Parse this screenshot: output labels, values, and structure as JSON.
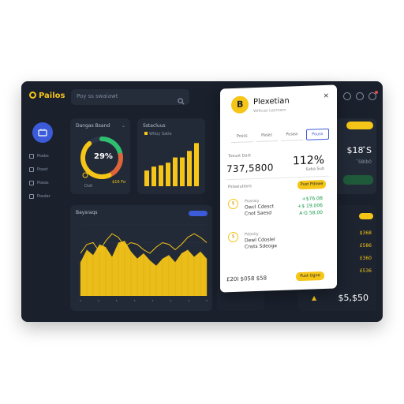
{
  "app": {
    "brand": "Pailos"
  },
  "search": {
    "placeholder": "Poy ss swaiawt"
  },
  "sidebar": {
    "items": [
      {
        "label": "Poabs"
      },
      {
        "label": "Poast"
      },
      {
        "label": "Poeas"
      },
      {
        "label": "Posdar"
      }
    ]
  },
  "cards": {
    "donut": {
      "title": "Dangas Bsand",
      "value": "29%",
      "left_note": "Dotl",
      "right_note": "$16 Fo"
    },
    "bars": {
      "title": "Sstacluus",
      "legend": "Wtloy Satle"
    },
    "area": {
      "title": "Baysraqs"
    },
    "right_top": {
      "big": "$18 ̂S",
      "sub": "ˆS8Ib0"
    },
    "right_bottom": {
      "rows": [
        "$368",
        "£586",
        "£360",
        "£536"
      ],
      "total": "$5,$50"
    }
  },
  "popup": {
    "icon_char": "B",
    "title": "Plexetian",
    "subtitle": "Wrltcas Lesroam",
    "close": "×",
    "tabs": [
      "Posss",
      "Pasec",
      "Posea",
      "Pouss"
    ],
    "meta": "Toeust Dast",
    "amount": "737,5800",
    "percent": "112%",
    "percent_sub": "$aba Sub",
    "section": "Pstseiutlons",
    "button1": "Pust Pdowe",
    "item1": {
      "line1": "Poaraiy",
      "line2": "Owcl Cdesct",
      "line3": "Cnot Saesd",
      "r1": "+$76.0B",
      "r2": "+$ 19.006",
      "r3": "A·G 58,00"
    },
    "item2": {
      "line1": "Pdosiiy",
      "line2": "Dewl Cdoslel",
      "line3": "Cnsts Sdeoga"
    },
    "footer": "£20I $058 $58",
    "button2": "Pust Ogne"
  },
  "chart_data": [
    {
      "type": "donut",
      "values": [
        29,
        71
      ],
      "value_label": "29%"
    },
    {
      "type": "bar",
      "values": [
        12,
        15,
        16,
        18,
        22,
        22,
        27,
        33
      ]
    },
    {
      "type": "area",
      "x": [
        0,
        1,
        2,
        3,
        4,
        5,
        6,
        7,
        8,
        9,
        10,
        11,
        12,
        13,
        14,
        15,
        16,
        17,
        18,
        19,
        20
      ],
      "values": [
        38,
        52,
        46,
        58,
        55,
        44,
        60,
        62,
        50,
        42,
        48,
        40,
        34,
        42,
        46,
        38,
        48,
        52,
        44,
        50,
        42
      ],
      "overlay": [
        48,
        58,
        60,
        50,
        62,
        70,
        66,
        56,
        60,
        58,
        52,
        48,
        55,
        60,
        58,
        52,
        58,
        66,
        70,
        66,
        60
      ],
      "colors": {
        "area": "#f5c518",
        "line": "#f5c518"
      }
    }
  ],
  "colors": {
    "accent": "#f5c518",
    "background": "#1a202c",
    "card": "#222a37",
    "primary_blue": "#3b5bd9"
  }
}
